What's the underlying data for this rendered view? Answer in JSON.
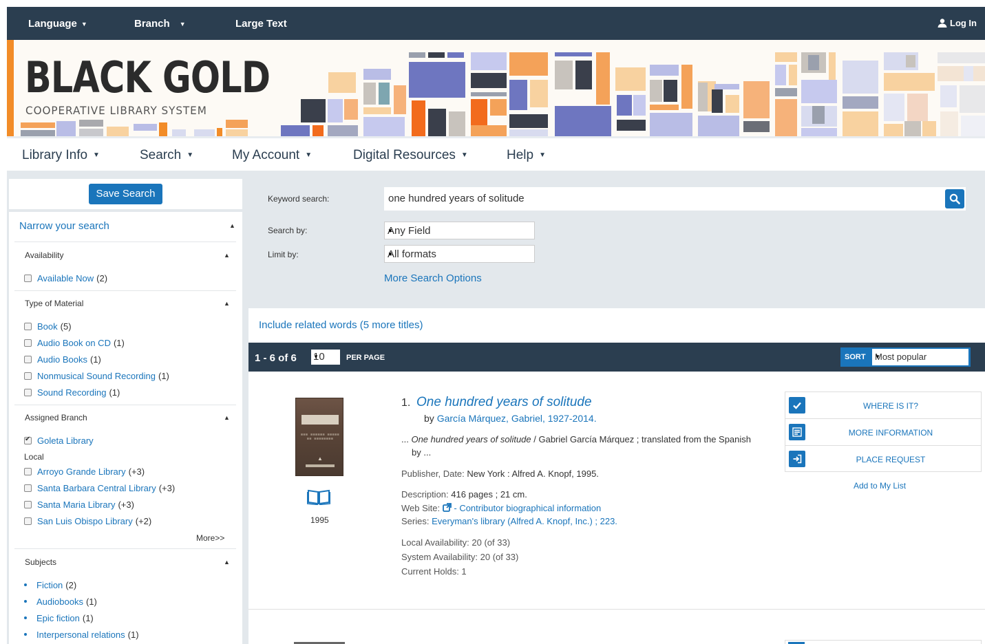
{
  "topbar": {
    "language": "Language",
    "branch": "Branch",
    "large_text": "Large Text",
    "login": "Log In"
  },
  "banner": {
    "title": "BLACK GOLD",
    "subtitle": "COOPERATIVE LIBRARY SYSTEM"
  },
  "mainnav": {
    "items": [
      "Library Info",
      "Search",
      "My Account",
      "Digital Resources",
      "Help"
    ]
  },
  "sidebar": {
    "save_search": "Save Search",
    "narrow": "Narrow your search",
    "availability": {
      "heading": "Availability",
      "items": [
        {
          "label": "Available Now",
          "count": "(2)"
        }
      ]
    },
    "material": {
      "heading": "Type of Material",
      "items": [
        {
          "label": "Book",
          "count": "(5)"
        },
        {
          "label": "Audio Book on CD",
          "count": "(1)"
        },
        {
          "label": "Audio Books",
          "count": "(1)"
        },
        {
          "label": "Nonmusical Sound Recording",
          "count": "(1)"
        },
        {
          "label": "Sound Recording",
          "count": "(1)"
        }
      ]
    },
    "branch": {
      "heading": "Assigned Branch",
      "selected": {
        "label": "Goleta Library"
      },
      "local_label": "Local",
      "items": [
        {
          "label": "Arroyo Grande Library",
          "count": "(+3)"
        },
        {
          "label": "Santa Barbara Central Library",
          "count": "(+3)"
        },
        {
          "label": "Santa Maria Library",
          "count": "(+3)"
        },
        {
          "label": "San Luis Obispo Library",
          "count": "(+2)"
        }
      ],
      "more": "More>>"
    },
    "subjects": {
      "heading": "Subjects",
      "items": [
        {
          "label": "Fiction",
          "count": "(2)"
        },
        {
          "label": "Audiobooks",
          "count": "(1)"
        },
        {
          "label": "Epic fiction",
          "count": "(1)"
        },
        {
          "label": "Interpersonal relations",
          "count": "(1)"
        }
      ]
    }
  },
  "search": {
    "keyword_label": "Keyword search:",
    "keyword_value": "one hundred years of solitude",
    "searchby_label": "Search by:",
    "searchby_value": "Any Field",
    "limitby_label": "Limit by:",
    "limitby_value": "All formats",
    "more_options": "More Search Options"
  },
  "results": {
    "related": "Include related words (5 more titles)",
    "count": "1 - 6 of 6",
    "per_page_value": "10",
    "per_page_label": "PER PAGE",
    "sort_label": "SORT",
    "sort_value": "Most popular",
    "items": [
      {
        "number": "1.",
        "title": "One hundred years of solitude",
        "by_prefix": "by",
        "author": "García Márquez, Gabriel, 1927-2014.",
        "snippet_prefix": "...",
        "snippet_title": "One hundred years of solitude",
        "snippet_rest": " / Gabriel García Márquez ; translated from the Spanish",
        "snippet_line2": "by ...",
        "publisher_label": "Publisher, Date:",
        "publisher_value": "New York : Alfred A. Knopf, 1995.",
        "description_label": "Description:",
        "description_value": "416 pages ; 21 cm.",
        "website_label": "Web Site:",
        "website_value": "- Contributor biographical information",
        "series_label": "Series:",
        "series_value": "Everyman's library (Alfred A. Knopf, Inc.) ; 223.",
        "local_avail": "Local Availability: 20 (of 33)",
        "system_avail": "System Availability: 20 (of 33)",
        "holds": "Current Holds: 1",
        "year": "1995",
        "actions": [
          "WHERE IS IT?",
          "MORE INFORMATION",
          "PLACE REQUEST"
        ],
        "add_list": "Add to My List"
      }
    ]
  },
  "colors": {
    "navy": "#2b3e50",
    "link": "#1a75bb",
    "panel": "#e3e8ec"
  }
}
